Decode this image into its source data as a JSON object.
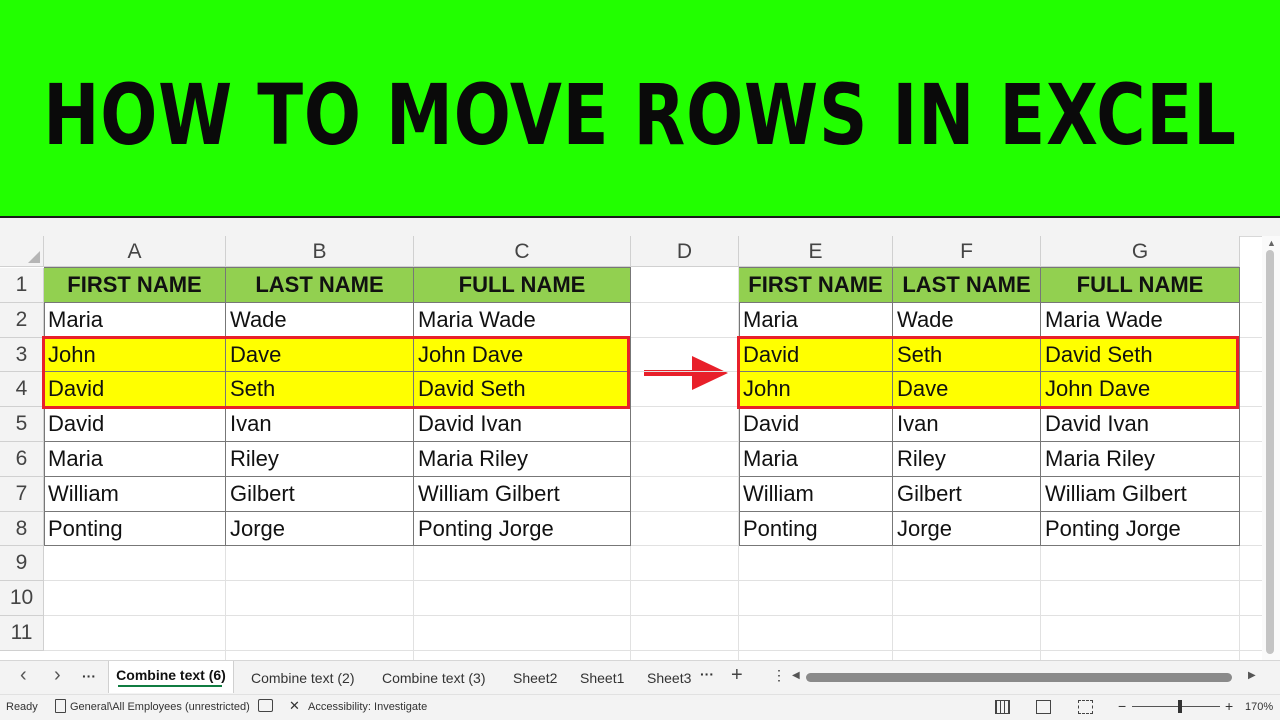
{
  "banner": {
    "title": "HOW TO MOVE ROWS IN EXCEL"
  },
  "columns": [
    "A",
    "B",
    "C",
    "D",
    "E",
    "F",
    "G"
  ],
  "rows": [
    "1",
    "2",
    "3",
    "4",
    "5",
    "6",
    "7",
    "8",
    "9",
    "10",
    "11"
  ],
  "left_table": {
    "headers": [
      "FIRST NAME",
      "LAST NAME",
      "FULL NAME"
    ],
    "rows": [
      [
        "Maria",
        "Wade",
        "Maria Wade"
      ],
      [
        "John",
        "Dave",
        "John Dave"
      ],
      [
        "David",
        "Seth",
        "David Seth"
      ],
      [
        "David",
        "Ivan",
        "David Ivan"
      ],
      [
        "Maria",
        "Riley",
        "Maria Riley"
      ],
      [
        "William",
        "Gilbert",
        "William Gilbert"
      ],
      [
        "Ponting",
        "Jorge",
        "Ponting Jorge"
      ]
    ],
    "highlighted_rows": [
      1,
      2
    ]
  },
  "right_table": {
    "headers": [
      "FIRST NAME",
      "LAST NAME",
      "FULL NAME"
    ],
    "rows": [
      [
        "Maria",
        "Wade",
        "Maria Wade"
      ],
      [
        "David",
        "Seth",
        "David Seth"
      ],
      [
        "John",
        "Dave",
        "John Dave"
      ],
      [
        "David",
        "Ivan",
        "David Ivan"
      ],
      [
        "Maria",
        "Riley",
        "Maria Riley"
      ],
      [
        "William",
        "Gilbert",
        "William Gilbert"
      ],
      [
        "Ponting",
        "Jorge",
        "Ponting Jorge"
      ]
    ],
    "highlighted_rows": [
      1,
      2
    ]
  },
  "colors": {
    "banner_bg": "#22ff00",
    "header_fill": "#92d050",
    "highlight_fill": "#ffff00",
    "selection_border": "#e8202a",
    "arrow": "#e8202a"
  },
  "sheet_tabs": {
    "nav_prev": "‹",
    "nav_next": "›",
    "nav_more": "···",
    "tabs": [
      "Combine text (6)",
      "Combine text (2)",
      "Combine text (3)",
      "Sheet2",
      "Sheet1",
      "Sheet3"
    ],
    "active_index": 0,
    "more": "···",
    "add": "+"
  },
  "status_bar": {
    "ready": "Ready",
    "sensitivity": "General\\All Employees (unrestricted)",
    "accessibility": "Accessibility: Investigate",
    "zoom_minus": "−",
    "zoom_plus": "+",
    "zoom": "170%"
  }
}
